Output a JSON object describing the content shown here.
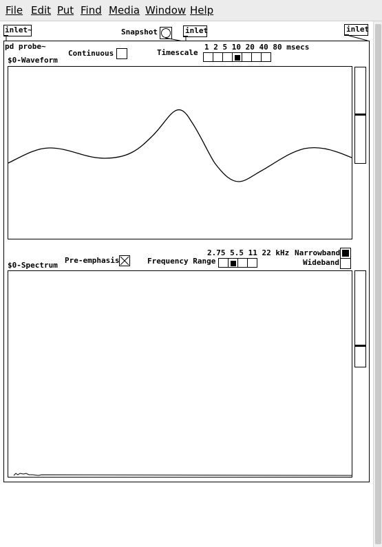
{
  "menu": [
    "File",
    "Edit",
    "Put",
    "Find",
    "Media",
    "Window",
    "Help"
  ],
  "top": {
    "inlet_tilde": "inlet~",
    "snapshot_label": "Snapshot",
    "inlet_mid": "inlet",
    "inlet_right": "inlet"
  },
  "probe": {
    "title": "pd probe~",
    "waveform_label": "$0-Waveform",
    "continuous_label": "Continuous",
    "timescale_label": "Timescale",
    "timescale_values": "1 2 5 10 20 40 80 msecs",
    "timescale_selected_index": 3,
    "spectrum_label": "$0-Spectrum",
    "preemphasis_label": "Pre-emphasis",
    "preemphasis_checked": true,
    "frequency_range_label": "Frequency Range",
    "frequency_values": "2.75 5.5 11 22 kHz",
    "frequency_selected_index": 1,
    "narrowband_label": "Narrowband",
    "narrowband_selected": true,
    "wideband_label": "Wideband",
    "wideband_selected": false
  }
}
